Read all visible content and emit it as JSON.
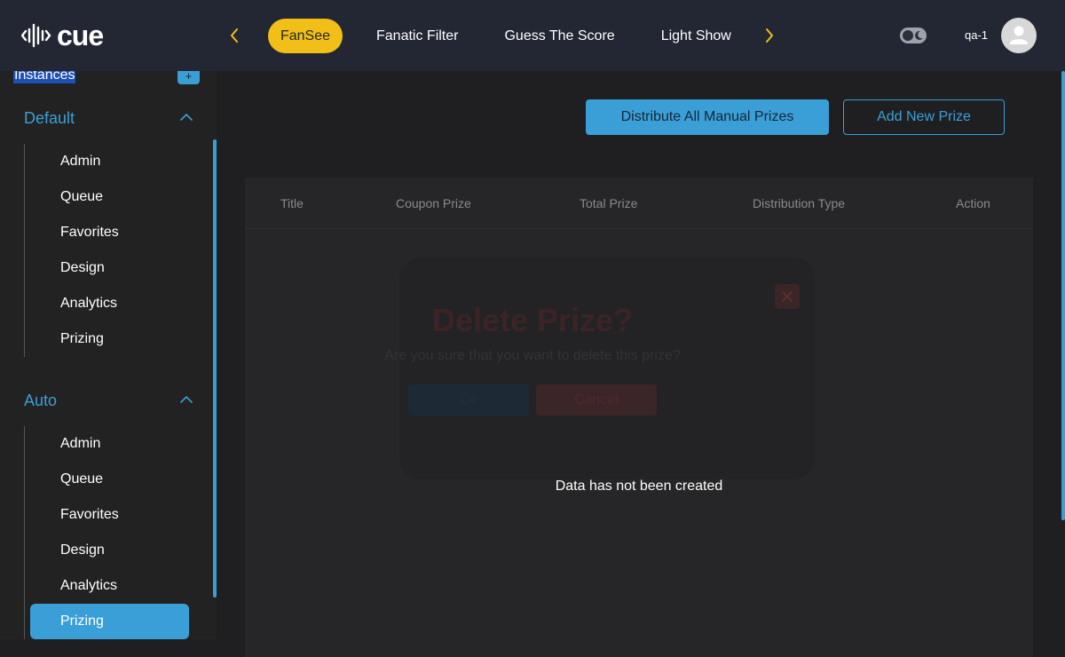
{
  "app": {
    "logo_text": "cue"
  },
  "header": {
    "games": [
      "FanSee",
      "Fanatic Filter",
      "Guess The Score",
      "Light Show"
    ],
    "active_game": "FanSee",
    "username": "qa-1"
  },
  "sidebar": {
    "instances_label": "Instances",
    "add_label": "+",
    "groups": [
      {
        "title": "Default",
        "items": [
          "Admin",
          "Queue",
          "Favorites",
          "Design",
          "Analytics",
          "Prizing"
        ]
      },
      {
        "title": "Auto",
        "items": [
          "Admin",
          "Queue",
          "Favorites",
          "Design",
          "Analytics",
          "Prizing"
        ]
      }
    ],
    "active_item": "Auto / Prizing"
  },
  "main": {
    "distribute_label": "Distribute All Manual Prizes",
    "add_prize_label": "Add New Prize",
    "table": {
      "columns": [
        "Title",
        "Coupon Prize",
        "Total Prize",
        "Distribution Type",
        "Action"
      ],
      "empty_message": "Data has not been created"
    },
    "modal": {
      "title": "Delete Prize?",
      "message": "Are you sure that you want to delete this prize?",
      "ok_label": "Ok",
      "cancel_label": "Cancel"
    }
  },
  "colors": {
    "accent": "#3a9fd6",
    "active_game_bg": "#f2bf18",
    "topbar_bg": "#222733",
    "sidebar_bg": "#222222",
    "main_bg": "#1f1f21"
  },
  "icons": [
    "cue-logo-icon",
    "chevron-left-icon",
    "chevron-right-icon",
    "moon-icon",
    "user-icon",
    "chevron-up-icon",
    "close-icon"
  ]
}
